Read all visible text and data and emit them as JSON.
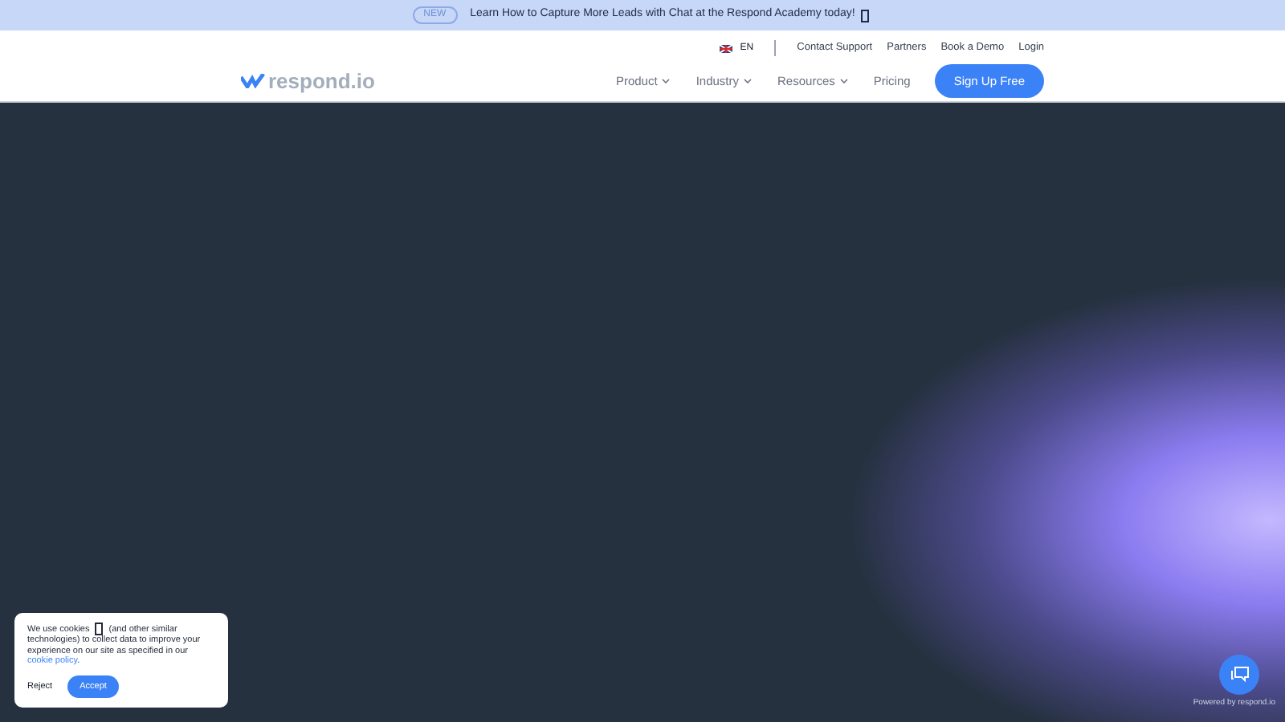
{
  "announcement": {
    "badge": "NEW",
    "text": "Learn How to Capture More Leads with Chat at the Respond Academy today!"
  },
  "topbar": {
    "language": "EN",
    "links": [
      "Contact Support",
      "Partners",
      "Book a Demo",
      "Login"
    ]
  },
  "nav": {
    "logo": "respond.io",
    "items": [
      {
        "label": "Product",
        "dropdown": true
      },
      {
        "label": "Industry",
        "dropdown": true
      },
      {
        "label": "Resources",
        "dropdown": true
      },
      {
        "label": "Pricing",
        "dropdown": false
      }
    ],
    "cta": "Sign Up Free"
  },
  "cookie_banner": {
    "text_before": "We use cookies",
    "text_after": "(and other similar technologies) to collect data to improve your experience on our site as specified in our",
    "link": "cookie policy",
    "end": ".",
    "buttons": [
      "Reject",
      "Accept"
    ]
  },
  "chat_widget": {
    "powered_by": "Powered by respond.io"
  }
}
